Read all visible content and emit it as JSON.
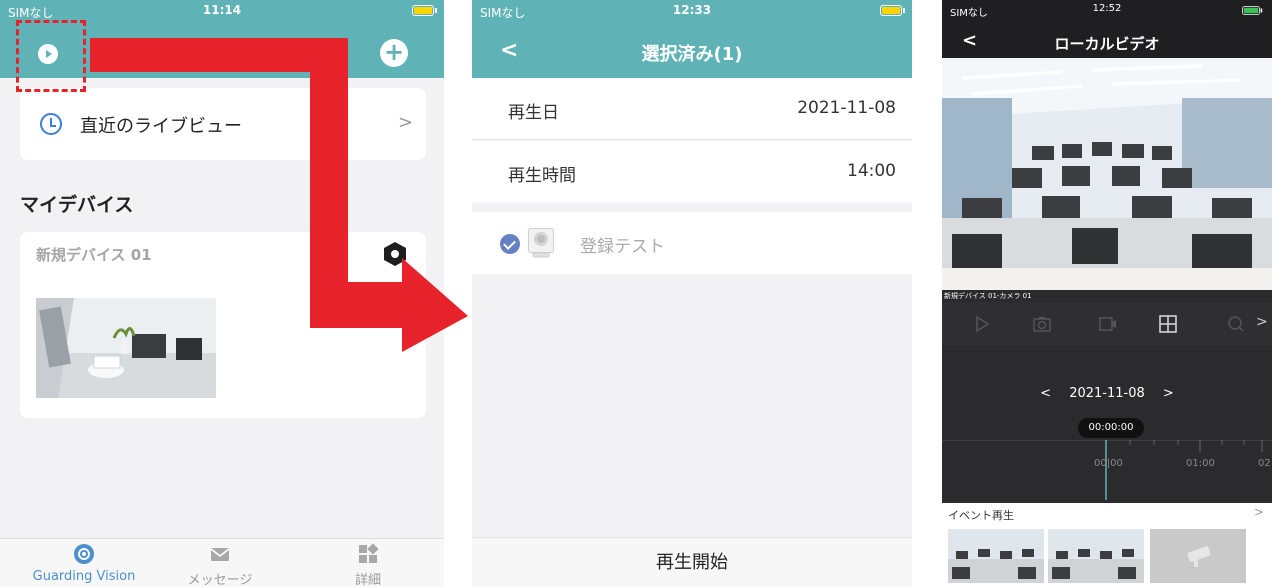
{
  "screen1": {
    "status": {
      "carrier": "SIMなし",
      "time": "11:14"
    },
    "live_view_label": "直近のライブビュー",
    "chevron": ">",
    "section_title": "マイデバイス",
    "device_name": "新規デバイス 01",
    "plus_symbol": "+",
    "tabs": [
      {
        "label": "Guarding Vision",
        "icon": "guarding-vision-icon",
        "active": true
      },
      {
        "label": "メッセージ",
        "icon": "mail-icon",
        "active": false
      },
      {
        "label": "詳細",
        "icon": "grid-icon",
        "active": false
      }
    ]
  },
  "screen2": {
    "status": {
      "carrier": "SIMなし",
      "time": "12:33"
    },
    "back": "<",
    "title": "選択済み(1)",
    "rows": [
      {
        "label": "再生日",
        "value": "2021-11-08"
      },
      {
        "label": "再生時間",
        "value": "14:00"
      }
    ],
    "camera_item": {
      "label": "登録テスト",
      "checked": true
    },
    "start_button": "再生開始"
  },
  "screen3": {
    "status": {
      "carrier": "SIMなし",
      "time": "12:52"
    },
    "back": "<",
    "title": "ローカルビデオ",
    "camera_caption": "新規デバイス 01-カメラ 01",
    "toolbar_more": ">",
    "date_prev": "<",
    "date": "2021-11-08",
    "date_next": ">",
    "time_pill": "00:00:00",
    "timeline_labels": [
      "00|00",
      "01:00",
      "02"
    ],
    "event_label": "イベント再生",
    "event_chevron": ">"
  },
  "colors": {
    "teal": "#5fb2b6",
    "red_arrow": "#e8222b",
    "check_blue": "#6680c4",
    "active_tab": "#4a8fd0",
    "battery": "#ffd500"
  }
}
